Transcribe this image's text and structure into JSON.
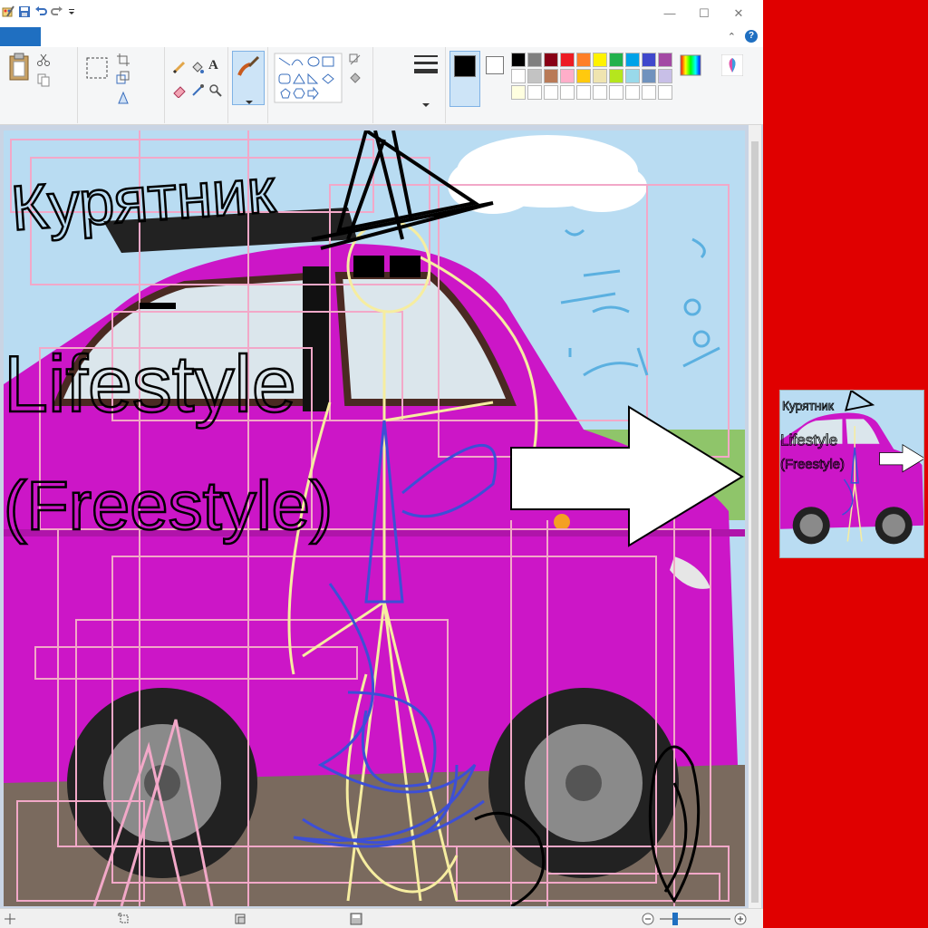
{
  "window": {
    "minimize_glyph": "—",
    "maximize_glyph": "☐",
    "close_glyph": "✕"
  },
  "ribbon": {
    "collapse_glyph": "⌃",
    "help_glyph": "?",
    "text_tool_glyph": "A"
  },
  "colors": {
    "accent": "#1f6fc1",
    "desktop_background": "#e00000",
    "car_body": "#cc16c7",
    "sky": "#b9dcf2",
    "arrow_fill": "#ffffff",
    "primary_color": "#000000",
    "secondary_color": "#ffffff"
  },
  "palette": [
    "#000000",
    "#7f7f7f",
    "#880015",
    "#ed1c24",
    "#ff7f27",
    "#fff200",
    "#22b14c",
    "#00a2e8",
    "#3f48cc",
    "#a349a4",
    "#ffffff",
    "#c3c3c3",
    "#b97a57",
    "#ffaec9",
    "#ffc90e",
    "#efe4b0",
    "#b5e61d",
    "#99d9ea",
    "#7092be",
    "#c8bfe7",
    "#ffffe0",
    "#ffffff",
    "#ffffff",
    "#ffffff",
    "#ffffff",
    "#ffffff",
    "#ffffff",
    "#ffffff",
    "#ffffff",
    "#ffffff"
  ],
  "canvas": {
    "line1": "Курятник",
    "line2": "Lifestyle",
    "line3": "(Freestyle)"
  },
  "icons": [
    "paint-app-icon",
    "save-icon",
    "undo-icon",
    "redo-icon",
    "customize-qat-icon",
    "paste-icon",
    "cut-icon",
    "copy-icon",
    "select-icon",
    "crop-icon",
    "resize-icon",
    "rotate-icon",
    "pencil-icon",
    "fill-icon",
    "text-icon",
    "eraser-icon",
    "color-picker-icon",
    "magnifier-icon",
    "brush-icon",
    "shapes-icon",
    "outline-icon",
    "fill-shape-icon",
    "size-icon",
    "edit-colors-icon",
    "paint3d-icon",
    "add-text-icon",
    "selection-size-icon",
    "canvas-size-icon",
    "disk-icon",
    "zoom-out-icon",
    "zoom-in-icon"
  ]
}
